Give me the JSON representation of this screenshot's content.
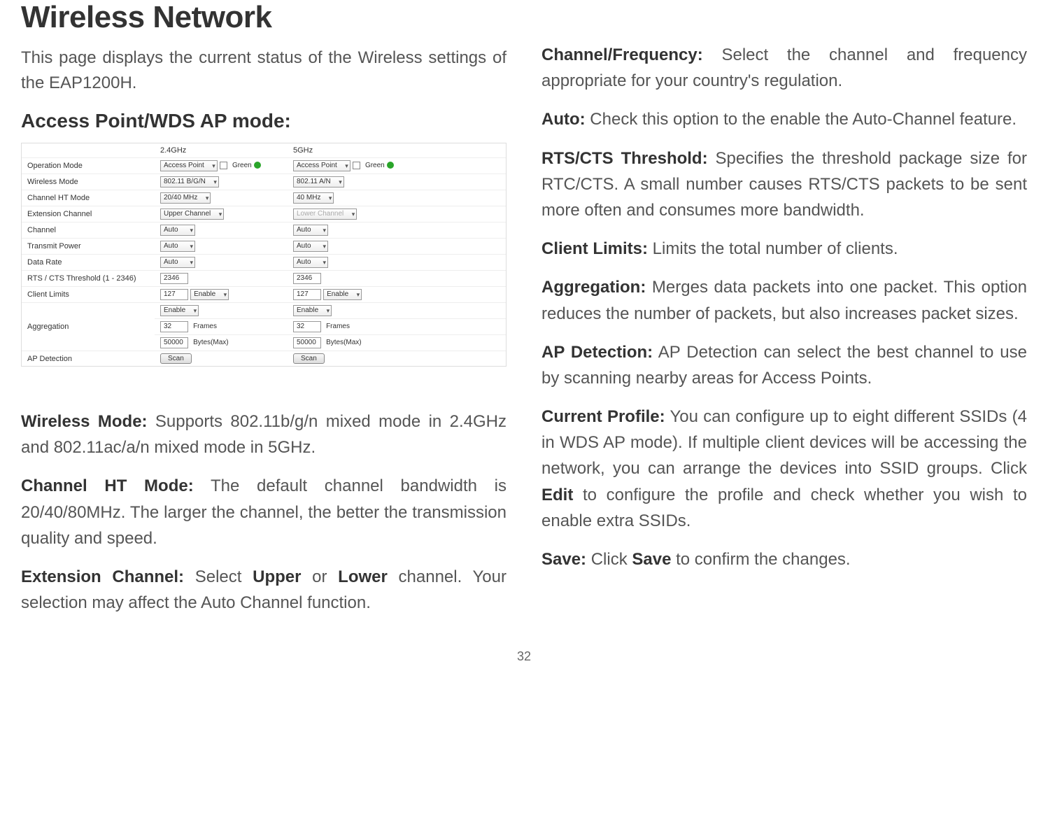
{
  "page_number": "32",
  "title": "Wireless Network",
  "intro": "This page displays the current status of the Wireless settings of the EAP1200H.",
  "subheading": "Access Point/WDS AP mode:",
  "screenshot": {
    "col24": "2.4GHz",
    "col5": "5GHz",
    "rows": {
      "operation_mode": "Operation Mode",
      "wireless_mode": "Wireless Mode",
      "channel_ht": "Channel HT Mode",
      "extension": "Extension Channel",
      "channel": "Channel",
      "tx_power": "Transmit Power",
      "data_rate": "Data Rate",
      "rts": "RTS / CTS Threshold (1 - 2346)",
      "client_limits": "Client Limits",
      "aggregation": "Aggregation",
      "ap_detection": "AP Detection"
    },
    "vals": {
      "ap": "Access Point",
      "green": "Green",
      "bgn": "802.11 B/G/N",
      "an": "802.11 A/N",
      "ht2040": "20/40 MHz",
      "ht40": "40 MHz",
      "upper": "Upper Channel",
      "lower": "Lower Channel",
      "auto": "Auto",
      "rtsval": "2346",
      "clients": "127",
      "enable": "Enable",
      "frames": "32",
      "frames_lbl": "Frames",
      "bytes": "50000",
      "bytes_lbl": "Bytes(Max)",
      "scan": "Scan"
    }
  },
  "left_paras": {
    "wireless_mode_b": "Wireless Mode:",
    "wireless_mode_t": " Supports 802.11b/g/n mixed mode in 2.4GHz and 802.11ac/a/n mixed mode in 5GHz.",
    "channel_ht_b": "Channel HT Mode:",
    "channel_ht_t": " The default channel bandwidth is 20/40/80MHz. The larger the channel, the better the transmission quality and speed.",
    "ext_b": "Extension Channel:",
    "ext_t1": " Select ",
    "ext_upper": "Upper",
    "ext_or": " or ",
    "ext_lower": "Lower",
    "ext_t2": " channel. Your selection may affect the Auto Channel function."
  },
  "right_paras": {
    "chfreq_b": "Channel/Frequency:",
    "chfreq_t": " Select the channel and frequency appropriate for your country's regulation.",
    "auto_b": "Auto:",
    "auto_t": " Check this option to the enable the Auto-Channel feature.",
    "rts_b": "RTS/CTS Threshold:",
    "rts_t": " Specifies the threshold package size for RTC/CTS. A small number causes RTS/CTS packets to be sent more often and consumes more bandwidth.",
    "climits_b": "Client Limits:",
    "climits_t": " Limits the total number of clients.",
    "agg_b": "Aggregation:",
    "agg_t": " Merges data packets into one packet. This option reduces the number of packets, but also increases packet sizes.",
    "apdet_b": "AP Detection:",
    "apdet_t": " AP Detection can select the best channel to use by scanning nearby areas for Access Points.",
    "curprof_b": "Current Profile:",
    "curprof_t1": " You can configure up to eight different SSIDs (4 in WDS AP mode). If multiple client devices will be accessing the network, you can arrange the devices into SSID groups. Click ",
    "curprof_edit": "Edit",
    "curprof_t2": " to configure the profile and check whether you  wish to enable extra SSIDs.",
    "save_b": "Save:",
    "save_t1": " Click ",
    "save_word": "Save",
    "save_t2": " to confirm the changes."
  }
}
